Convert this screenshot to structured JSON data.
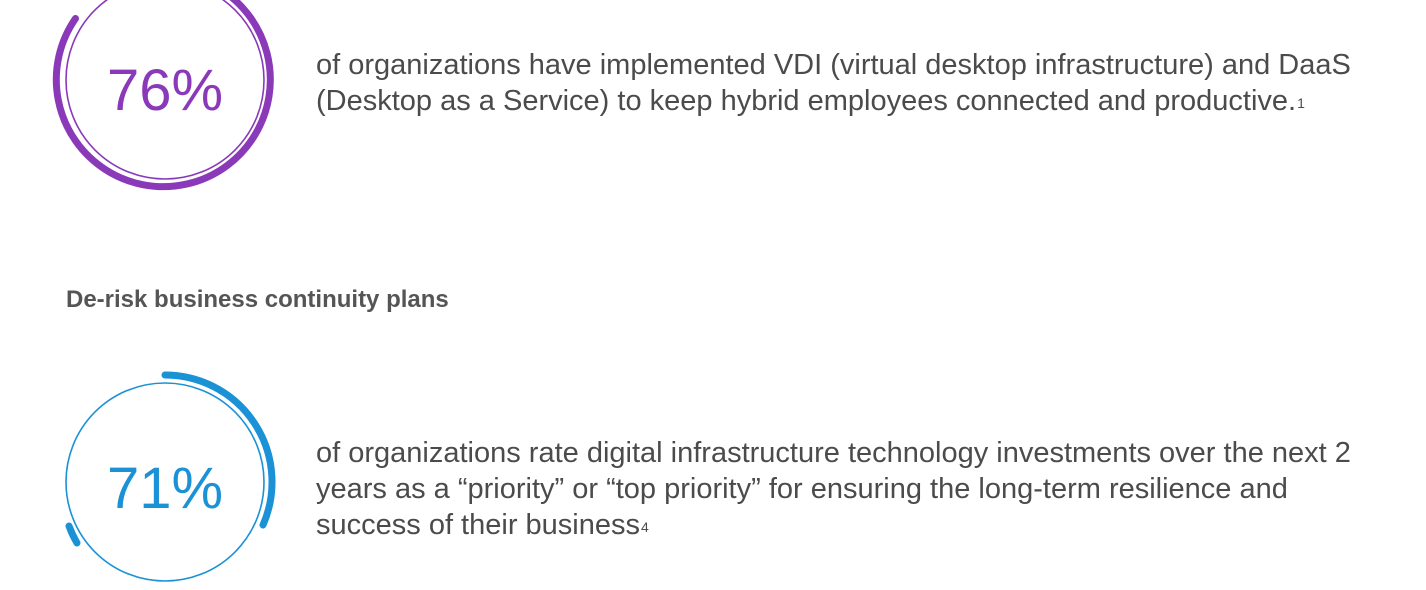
{
  "stats": [
    {
      "value": "76%",
      "text": "of organizations have implemented VDI (virtual desktop infrastructure) and DaaS (Desktop as a Service) to keep hybrid employees connected and productive.",
      "footnote": "1",
      "color": "#8a3ab9",
      "ring_level": 0.44
    },
    {
      "value": "71%",
      "text": "of organizations rate digital infrastructure technology investments over the next 2 years as a “priority” or “top priority” for ensuring the long-term resilience and success of their business",
      "footnote": "4",
      "color": "#1b91d6",
      "ring_level": 0.4
    }
  ],
  "section": {
    "heading": "De-risk business continuity plans"
  }
}
